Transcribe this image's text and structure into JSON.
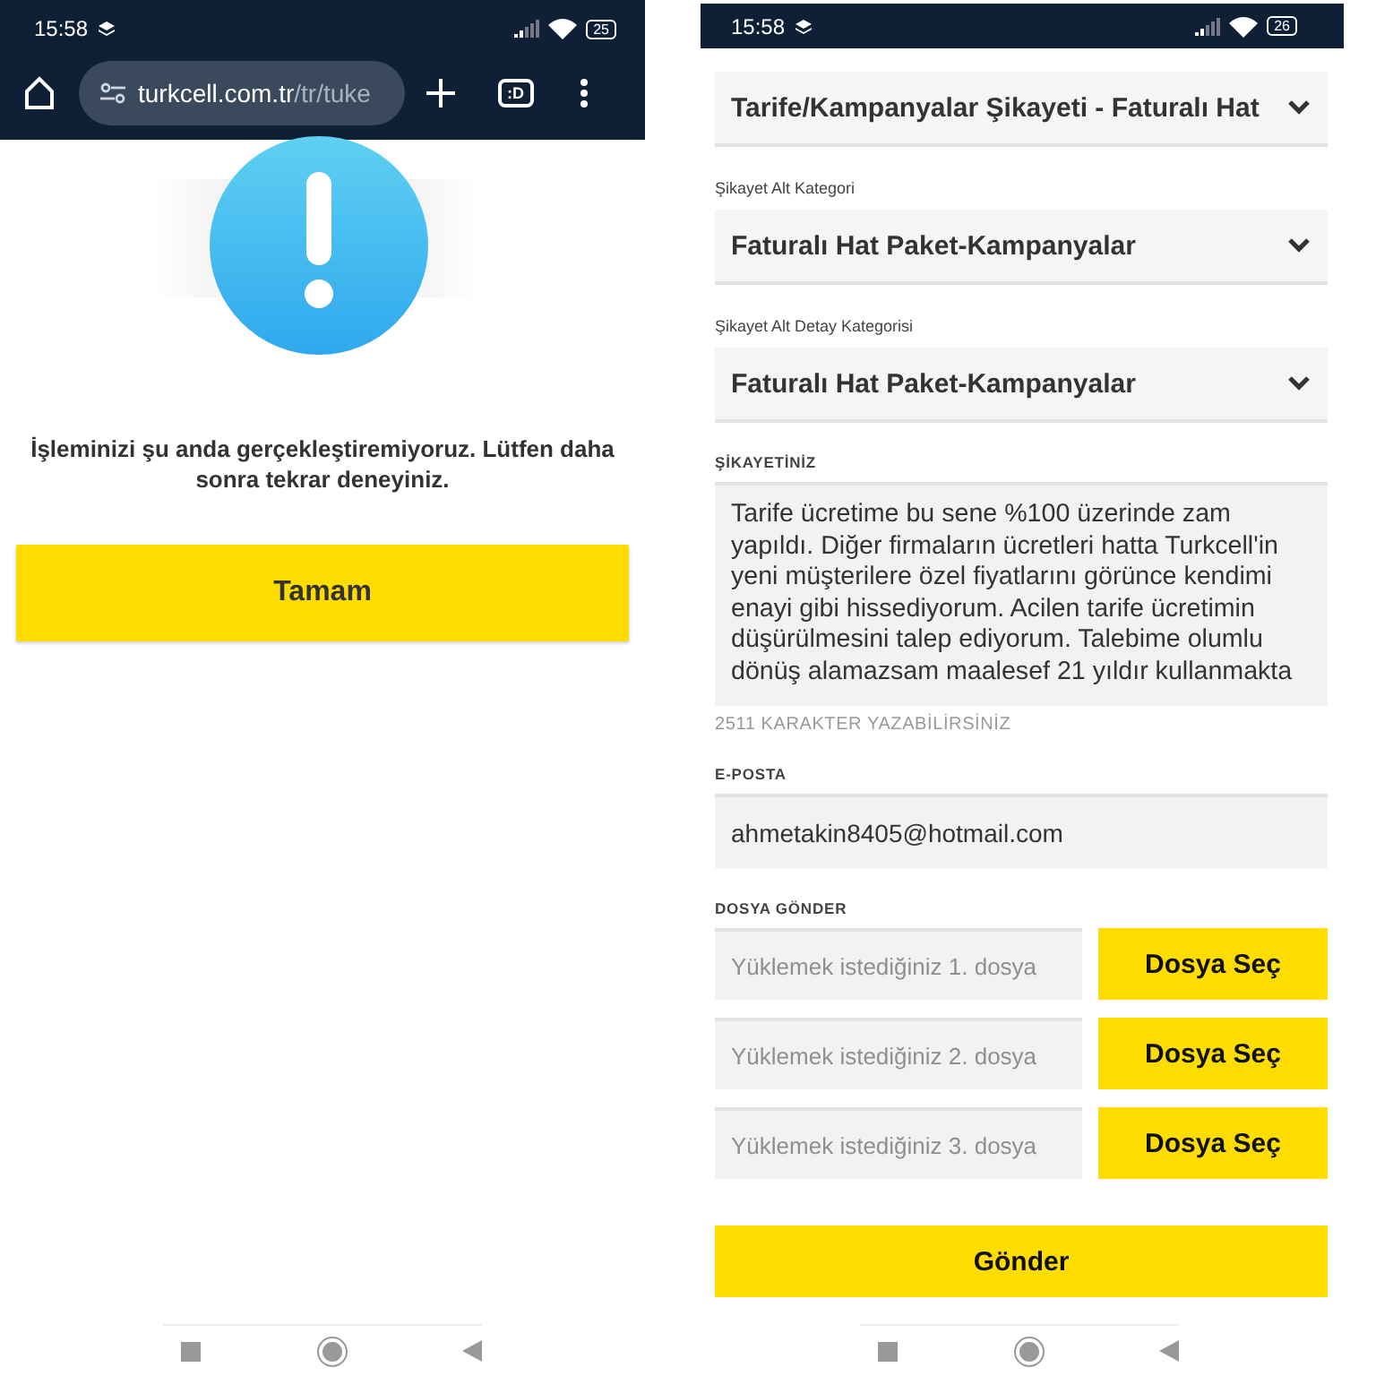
{
  "error_screen": {
    "status_bar": {
      "time": "15:58",
      "battery": "25"
    },
    "address_bar": {
      "domain": "turkcell.com.tr",
      "path": "/tr/tuke",
      "tab_count": ":D"
    },
    "message": "İşleminizi şu anda gerçekleştiremiyoruz. Lütfen daha sonra tekrar deneyiniz.",
    "button": "Tamam"
  },
  "form_screen": {
    "status_bar": {
      "time": "15:58",
      "battery": "26"
    },
    "selects": [
      {
        "value": "Tarife/Kampanyalar Şikayeti - Faturalı Hat"
      },
      {
        "label": "Şikayet Alt Kategori",
        "value": "Faturalı Hat Paket-Kampanyalar"
      },
      {
        "label": "Şikayet Alt Detay Kategorisi",
        "value": "Faturalı Hat Paket-Kampanyalar"
      }
    ],
    "complaint": {
      "label": "ŞİKAYETİNİZ",
      "value": "Tarife ücretime bu sene %100 üzerinde zam yapıldı. Diğer firmaların ücretleri hatta Turkcell'in yeni müşterilere özel fiyatlarını görünce kendimi enayi gibi hissediyorum. Acilen tarife ücretimin düşürülmesini talep ediyorum. Talebime olumlu dönüş alamazsam maalesef 21 yıldır kullanmakta",
      "counter": "2511 KARAKTER YAZABİLİRSİNİZ"
    },
    "email": {
      "label": "E-POSTA",
      "value": "ahmetakin8405@hotmail.com"
    },
    "files": {
      "label": "DOSYA GÖNDER",
      "items": [
        {
          "placeholder": "Yüklemek istediğiniz 1. dosya",
          "button": "Dosya Seç"
        },
        {
          "placeholder": "Yüklemek istediğiniz 2. dosya",
          "button": "Dosya Seç"
        },
        {
          "placeholder": "Yüklemek istediğiniz 3. dosya",
          "button": "Dosya Seç"
        }
      ]
    },
    "submit": "Gönder"
  }
}
